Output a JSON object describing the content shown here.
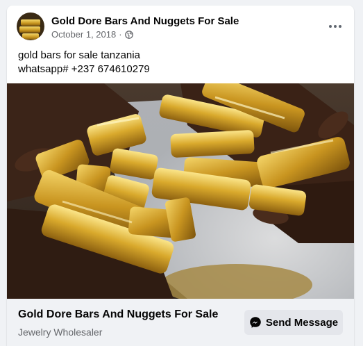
{
  "post": {
    "page_name": "Gold Dore Bars And Nuggets For Sale",
    "date": "October 1, 2018",
    "separator": "·",
    "privacy_icon": "globe-icon",
    "more_icon": "more-options-icon",
    "text_lines": [
      "gold bars for sale tanzania",
      "whatsapp# +237 674610279"
    ]
  },
  "link_preview": {
    "title": "Gold Dore Bars And Nuggets For Sale",
    "subtitle": "Jewelry Wholesaler",
    "button_label": "Send Message",
    "button_icon": "messenger-icon"
  },
  "colors": {
    "background": "#f0f2f5",
    "card": "#ffffff",
    "primary_text": "#050505",
    "secondary_text": "#65676b",
    "button_bg": "#e4e6eb",
    "gold": "#d4a62a"
  }
}
